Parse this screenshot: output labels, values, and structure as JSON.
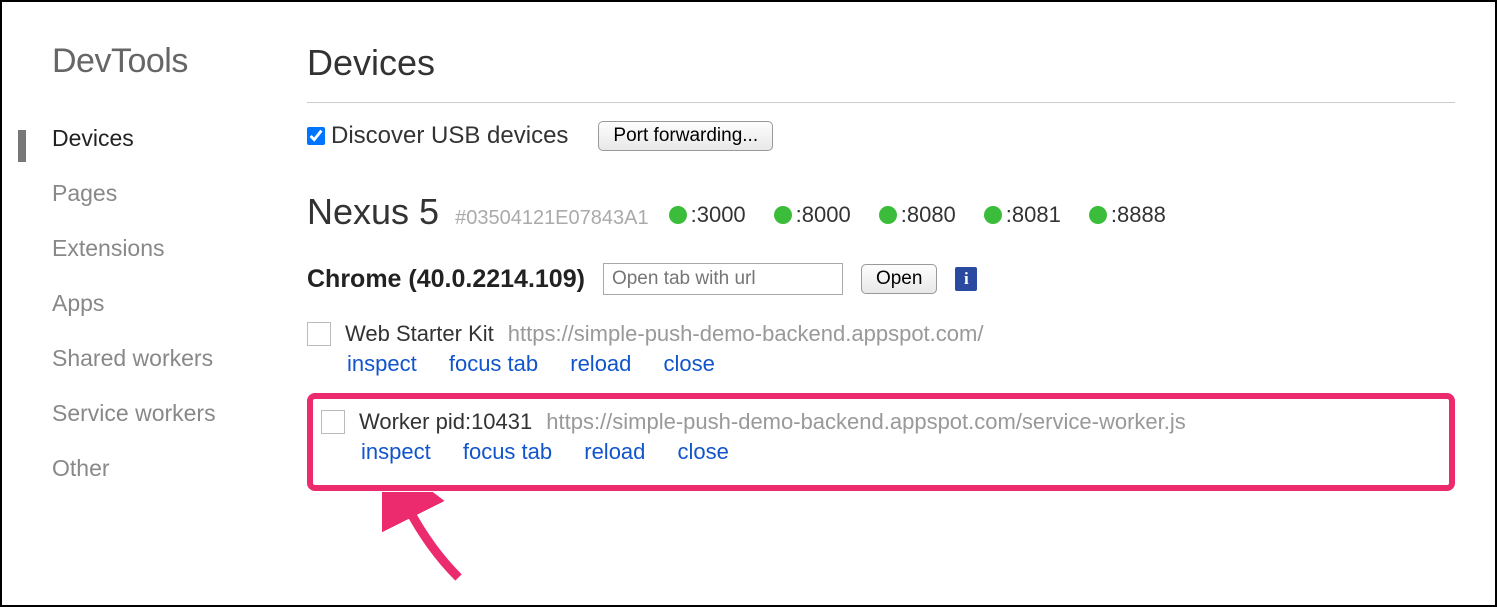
{
  "sidebar": {
    "title": "DevTools",
    "items": [
      {
        "label": "Devices",
        "active": true
      },
      {
        "label": "Pages"
      },
      {
        "label": "Extensions"
      },
      {
        "label": "Apps"
      },
      {
        "label": "Shared workers"
      },
      {
        "label": "Service workers"
      },
      {
        "label": "Other"
      }
    ]
  },
  "main": {
    "title": "Devices",
    "discover_label": "Discover USB devices",
    "discover_checked": true,
    "port_forwarding_button": "Port forwarding..."
  },
  "device": {
    "name": "Nexus 5",
    "id": "#03504121E07843A1",
    "ports": [
      ":3000",
      ":8000",
      ":8080",
      ":8081",
      ":8888"
    ]
  },
  "browser": {
    "label": "Chrome (40.0.2214.109)",
    "url_placeholder": "Open tab with url",
    "open_button": "Open"
  },
  "tabs": [
    {
      "title": "Web Starter Kit",
      "url": "https://simple-push-demo-backend.appspot.com/",
      "highlighted": false
    },
    {
      "title": "Worker pid:10431",
      "url": "https://simple-push-demo-backend.appspot.com/service-worker.js",
      "highlighted": true
    }
  ],
  "actions": {
    "inspect": "inspect",
    "focus_tab": "focus tab",
    "reload": "reload",
    "close": "close"
  },
  "colors": {
    "highlight": "#ec2a6e",
    "link": "#1155cc",
    "port_dot": "#3bbd3b"
  }
}
